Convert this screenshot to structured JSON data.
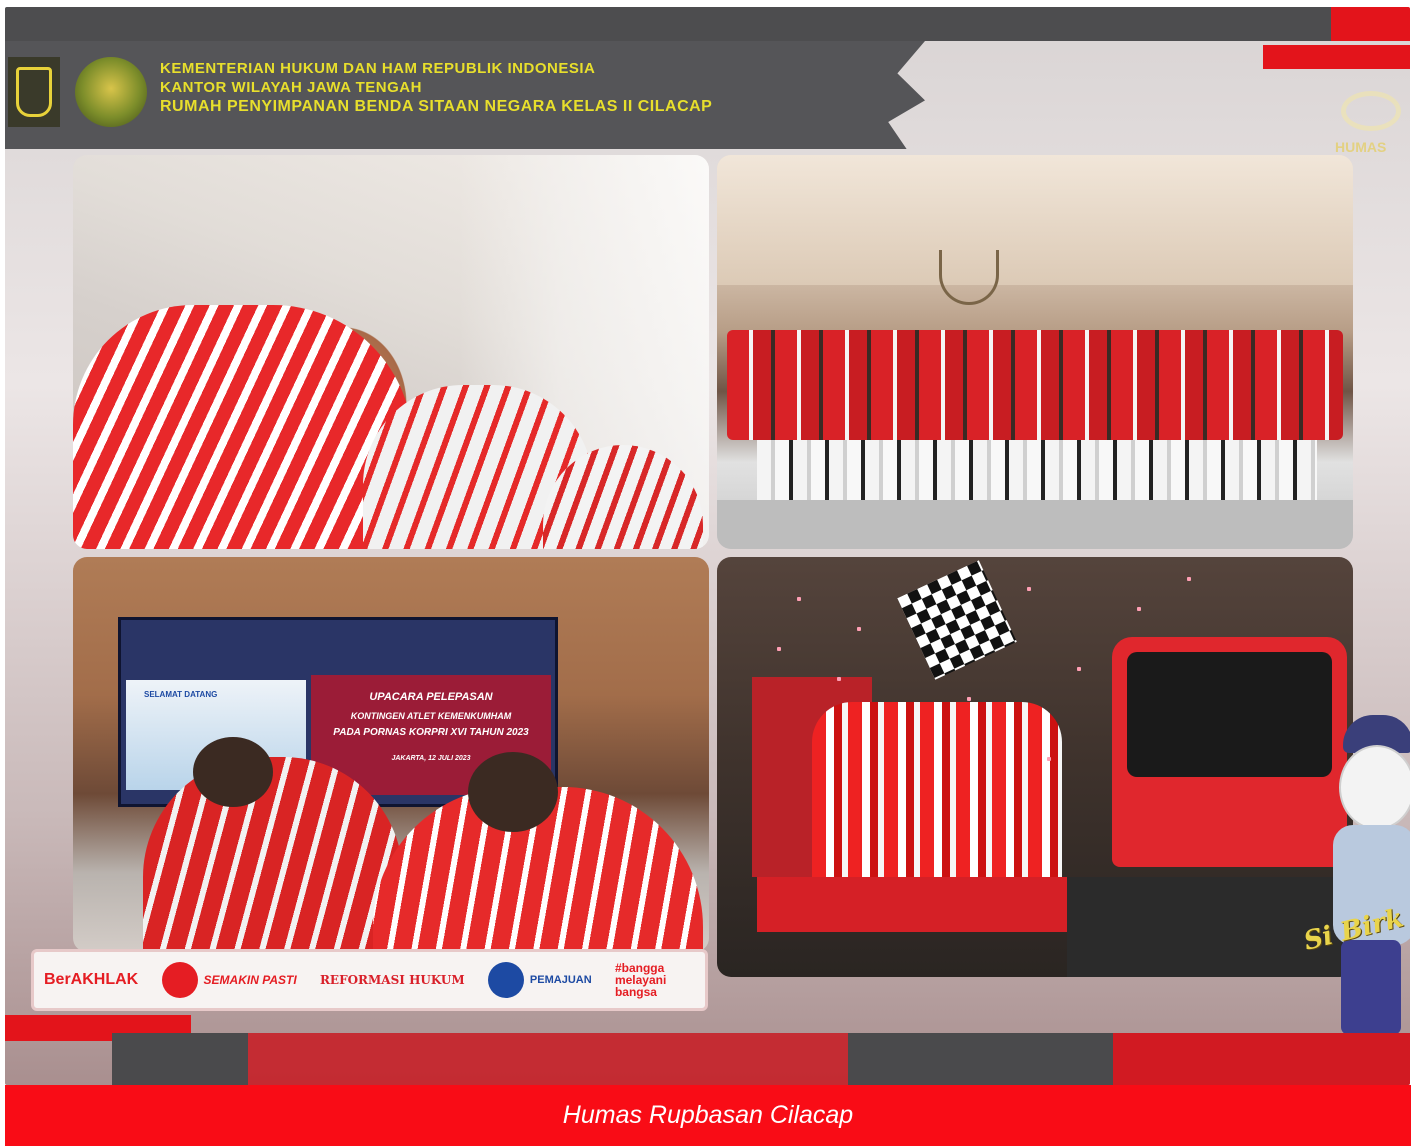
{
  "header": {
    "line1": "KEMENTERIAN HUKUM DAN HAM REPUBLIK INDONESIA",
    "line2": "KANTOR WILAYAH JAWA TENGAH",
    "line3": "RUMAH PENYIMPANAN BENDA SITAAN NEGARA KELAS II CILACAP"
  },
  "brand_mark": {
    "text": "HUMAS"
  },
  "screen": {
    "welcome": "SELAMAT DATANG",
    "title1": "UPACARA PELEPASAN",
    "title2": "KONTINGEN ATLET KEMENKUMHAM",
    "title3": "PADA PORNAS KORPRI XVI TAHUN 2023",
    "date": "JAKARTA, 12 JULI 2023"
  },
  "mascot": {
    "name": "Si Birk"
  },
  "badges": [
    {
      "text": "BerAKHLAK"
    },
    {
      "text": "SEMAKIN PASTI"
    },
    {
      "text": "REFORMASI HUKUM"
    },
    {
      "text": "PEMAJUAN"
    },
    {
      "text": "#bangga melayani bangsa"
    }
  ],
  "caption": "Humas Rupbasan Cilacap",
  "colors": {
    "accent_red": "#e3141b",
    "caption_bg": "#f90c16",
    "dark_band": "#4d4d4f",
    "header_text": "#e8df2c"
  }
}
